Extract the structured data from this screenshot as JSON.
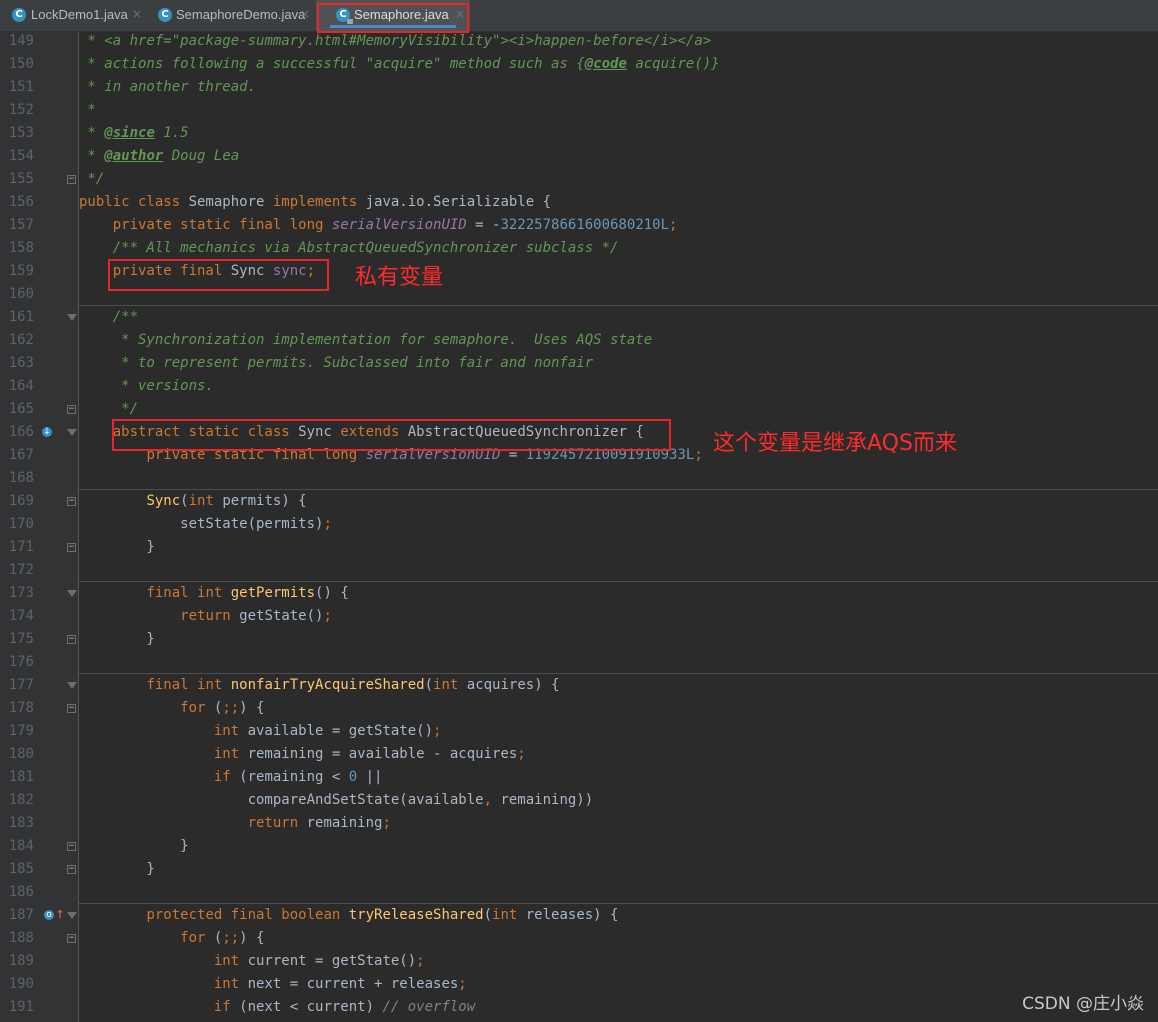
{
  "tabs": [
    {
      "label": "LockDemo1.java",
      "close": "×",
      "icon": "java-class-icon"
    },
    {
      "label": "SemaphoreDemo.java",
      "close": "×",
      "icon": "java-class-icon"
    },
    {
      "label": "Semaphore.java",
      "close": "×",
      "icon": "java-class-locked-icon",
      "active": true
    }
  ],
  "lines": [
    {
      "n": "149",
      "code": [
        [
          "cm",
          " * "
        ],
        [
          "tag",
          "<a "
        ],
        [
          "tag",
          "href=\"package-summary.html#MemoryVisibility\""
        ],
        [
          "tag",
          ">"
        ],
        [
          "tag",
          "<i>"
        ],
        [
          "cm",
          "happen-before"
        ],
        [
          "tag",
          "</i>"
        ],
        [
          "tag",
          "</a>"
        ]
      ]
    },
    {
      "n": "150",
      "code": [
        [
          "cm",
          " * actions following a successful \"acquire\" method such as {"
        ],
        [
          "jdt",
          "@code"
        ],
        [
          "cm",
          " acquire()}"
        ]
      ]
    },
    {
      "n": "151",
      "code": [
        [
          "cm",
          " * in another thread."
        ]
      ]
    },
    {
      "n": "152",
      "code": [
        [
          "cm",
          " *"
        ]
      ]
    },
    {
      "n": "153",
      "code": [
        [
          "cm",
          " * "
        ],
        [
          "jdt",
          "@since"
        ],
        [
          "cm",
          " 1.5"
        ]
      ]
    },
    {
      "n": "154",
      "code": [
        [
          "cm",
          " * "
        ],
        [
          "jdt",
          "@author"
        ],
        [
          "cm",
          " Doug Lea"
        ]
      ]
    },
    {
      "n": "155",
      "code": [
        [
          "cm",
          " */"
        ]
      ]
    },
    {
      "n": "156",
      "code": [
        [
          "kw",
          "public class "
        ],
        [
          "id",
          "Semaphore "
        ],
        [
          "kw",
          "implements "
        ],
        [
          "id",
          "java.io.Serializable {"
        ]
      ]
    },
    {
      "n": "157",
      "code": [
        [
          "id",
          "    "
        ],
        [
          "kw",
          "private static final long "
        ],
        [
          "fnm",
          "serialVersionUID"
        ],
        [
          "id",
          " = -"
        ],
        [
          "num",
          "3222578661600680210L"
        ],
        [
          "semi",
          ";"
        ]
      ]
    },
    {
      "n": "158",
      "code": [
        [
          "cm",
          "    /** All mechanics via AbstractQueuedSynchronizer subclass */"
        ]
      ]
    },
    {
      "n": "159",
      "code": [
        [
          "id",
          "    "
        ],
        [
          "kw",
          "private final "
        ],
        [
          "id",
          "Sync "
        ],
        [
          "fld",
          "sync"
        ],
        [
          "semi",
          ";"
        ]
      ]
    },
    {
      "n": "160",
      "code": []
    },
    {
      "n": "161",
      "code": [
        [
          "cm",
          "    /**"
        ]
      ]
    },
    {
      "n": "162",
      "code": [
        [
          "cm",
          "     * Synchronization implementation for semaphore.  Uses AQS state"
        ]
      ]
    },
    {
      "n": "163",
      "code": [
        [
          "cm",
          "     * to represent permits. Subclassed into fair and nonfair"
        ]
      ]
    },
    {
      "n": "164",
      "code": [
        [
          "cm",
          "     * versions."
        ]
      ]
    },
    {
      "n": "165",
      "code": [
        [
          "cm",
          "     */"
        ]
      ]
    },
    {
      "n": "166",
      "code": [
        [
          "id",
          "    "
        ],
        [
          "kw",
          "abstract static class "
        ],
        [
          "id",
          "Sync "
        ],
        [
          "kw",
          "extends "
        ],
        [
          "id",
          "AbstractQueuedSynchronizer {"
        ]
      ]
    },
    {
      "n": "167",
      "code": [
        [
          "id",
          "        "
        ],
        [
          "kw",
          "private static final long "
        ],
        [
          "fnm",
          "serialVersionUID"
        ],
        [
          "id",
          " = "
        ],
        [
          "num",
          "1192457210091910933L"
        ],
        [
          "semi",
          ";"
        ]
      ]
    },
    {
      "n": "168",
      "code": []
    },
    {
      "n": "169",
      "code": [
        [
          "id",
          "        "
        ],
        [
          "fn",
          "Sync"
        ],
        [
          "id",
          "("
        ],
        [
          "kw",
          "int "
        ],
        [
          "id",
          "permits) {"
        ]
      ]
    },
    {
      "n": "170",
      "code": [
        [
          "id",
          "            setState(permits)"
        ],
        [
          "semi",
          ";"
        ]
      ]
    },
    {
      "n": "171",
      "code": [
        [
          "id",
          "        }"
        ]
      ]
    },
    {
      "n": "172",
      "code": []
    },
    {
      "n": "173",
      "code": [
        [
          "id",
          "        "
        ],
        [
          "kw",
          "final int "
        ],
        [
          "fn",
          "getPermits"
        ],
        [
          "id",
          "() {"
        ]
      ]
    },
    {
      "n": "174",
      "code": [
        [
          "id",
          "            "
        ],
        [
          "kw",
          "return "
        ],
        [
          "id",
          "getState()"
        ],
        [
          "semi",
          ";"
        ]
      ]
    },
    {
      "n": "175",
      "code": [
        [
          "id",
          "        }"
        ]
      ]
    },
    {
      "n": "176",
      "code": []
    },
    {
      "n": "177",
      "code": [
        [
          "id",
          "        "
        ],
        [
          "kw",
          "final int "
        ],
        [
          "fn",
          "nonfairTryAcquireShared"
        ],
        [
          "id",
          "("
        ],
        [
          "kw",
          "int "
        ],
        [
          "id",
          "acquires) {"
        ]
      ]
    },
    {
      "n": "178",
      "code": [
        [
          "id",
          "            "
        ],
        [
          "kw",
          "for "
        ],
        [
          "id",
          "("
        ],
        [
          "semi",
          ";;"
        ],
        [
          "id",
          ") {"
        ]
      ]
    },
    {
      "n": "179",
      "code": [
        [
          "id",
          "                "
        ],
        [
          "kw",
          "int "
        ],
        [
          "id",
          "available = getState()"
        ],
        [
          "semi",
          ";"
        ]
      ]
    },
    {
      "n": "180",
      "code": [
        [
          "id",
          "                "
        ],
        [
          "kw",
          "int "
        ],
        [
          "id",
          "remaining = available - acquires"
        ],
        [
          "semi",
          ";"
        ]
      ]
    },
    {
      "n": "181",
      "code": [
        [
          "id",
          "                "
        ],
        [
          "kw",
          "if "
        ],
        [
          "id",
          "(remaining < "
        ],
        [
          "num",
          "0"
        ],
        [
          "id",
          " ||"
        ]
      ]
    },
    {
      "n": "182",
      "code": [
        [
          "id",
          "                    compareAndSetState(available"
        ],
        [
          "semi",
          ", "
        ],
        [
          "id",
          "remaining))"
        ]
      ]
    },
    {
      "n": "183",
      "code": [
        [
          "id",
          "                    "
        ],
        [
          "kw",
          "return "
        ],
        [
          "id",
          "remaining"
        ],
        [
          "semi",
          ";"
        ]
      ]
    },
    {
      "n": "184",
      "code": [
        [
          "id",
          "            }"
        ]
      ]
    },
    {
      "n": "185",
      "code": [
        [
          "id",
          "        }"
        ]
      ]
    },
    {
      "n": "186",
      "code": []
    },
    {
      "n": "187",
      "code": [
        [
          "id",
          "        "
        ],
        [
          "kw",
          "protected final boolean "
        ],
        [
          "fn",
          "tryReleaseShared"
        ],
        [
          "id",
          "("
        ],
        [
          "kw",
          "int "
        ],
        [
          "id",
          "releases) {"
        ]
      ]
    },
    {
      "n": "188",
      "code": [
        [
          "id",
          "            "
        ],
        [
          "kw",
          "for "
        ],
        [
          "id",
          "("
        ],
        [
          "semi",
          ";;"
        ],
        [
          "id",
          ") {"
        ]
      ]
    },
    {
      "n": "189",
      "code": [
        [
          "id",
          "                "
        ],
        [
          "kw",
          "int "
        ],
        [
          "id",
          "current = getState()"
        ],
        [
          "semi",
          ";"
        ]
      ]
    },
    {
      "n": "190",
      "code": [
        [
          "id",
          "                "
        ],
        [
          "kw",
          "int "
        ],
        [
          "id",
          "next = current + releases"
        ],
        [
          "semi",
          ";"
        ]
      ]
    },
    {
      "n": "191",
      "code": [
        [
          "id",
          "                "
        ],
        [
          "kw",
          "if "
        ],
        [
          "id",
          "(next < current) "
        ],
        [
          "lc",
          "// overflow"
        ]
      ]
    }
  ],
  "annotations": {
    "private_var": "私有变量",
    "inherit_aqs": "这个变量是继承AQS而来"
  },
  "watermark": "CSDN @庄小焱",
  "colors": {
    "background": "#2b2b2b",
    "keyword": "#cc7832",
    "comment": "#629755",
    "annotation": "#ff2b2b"
  }
}
